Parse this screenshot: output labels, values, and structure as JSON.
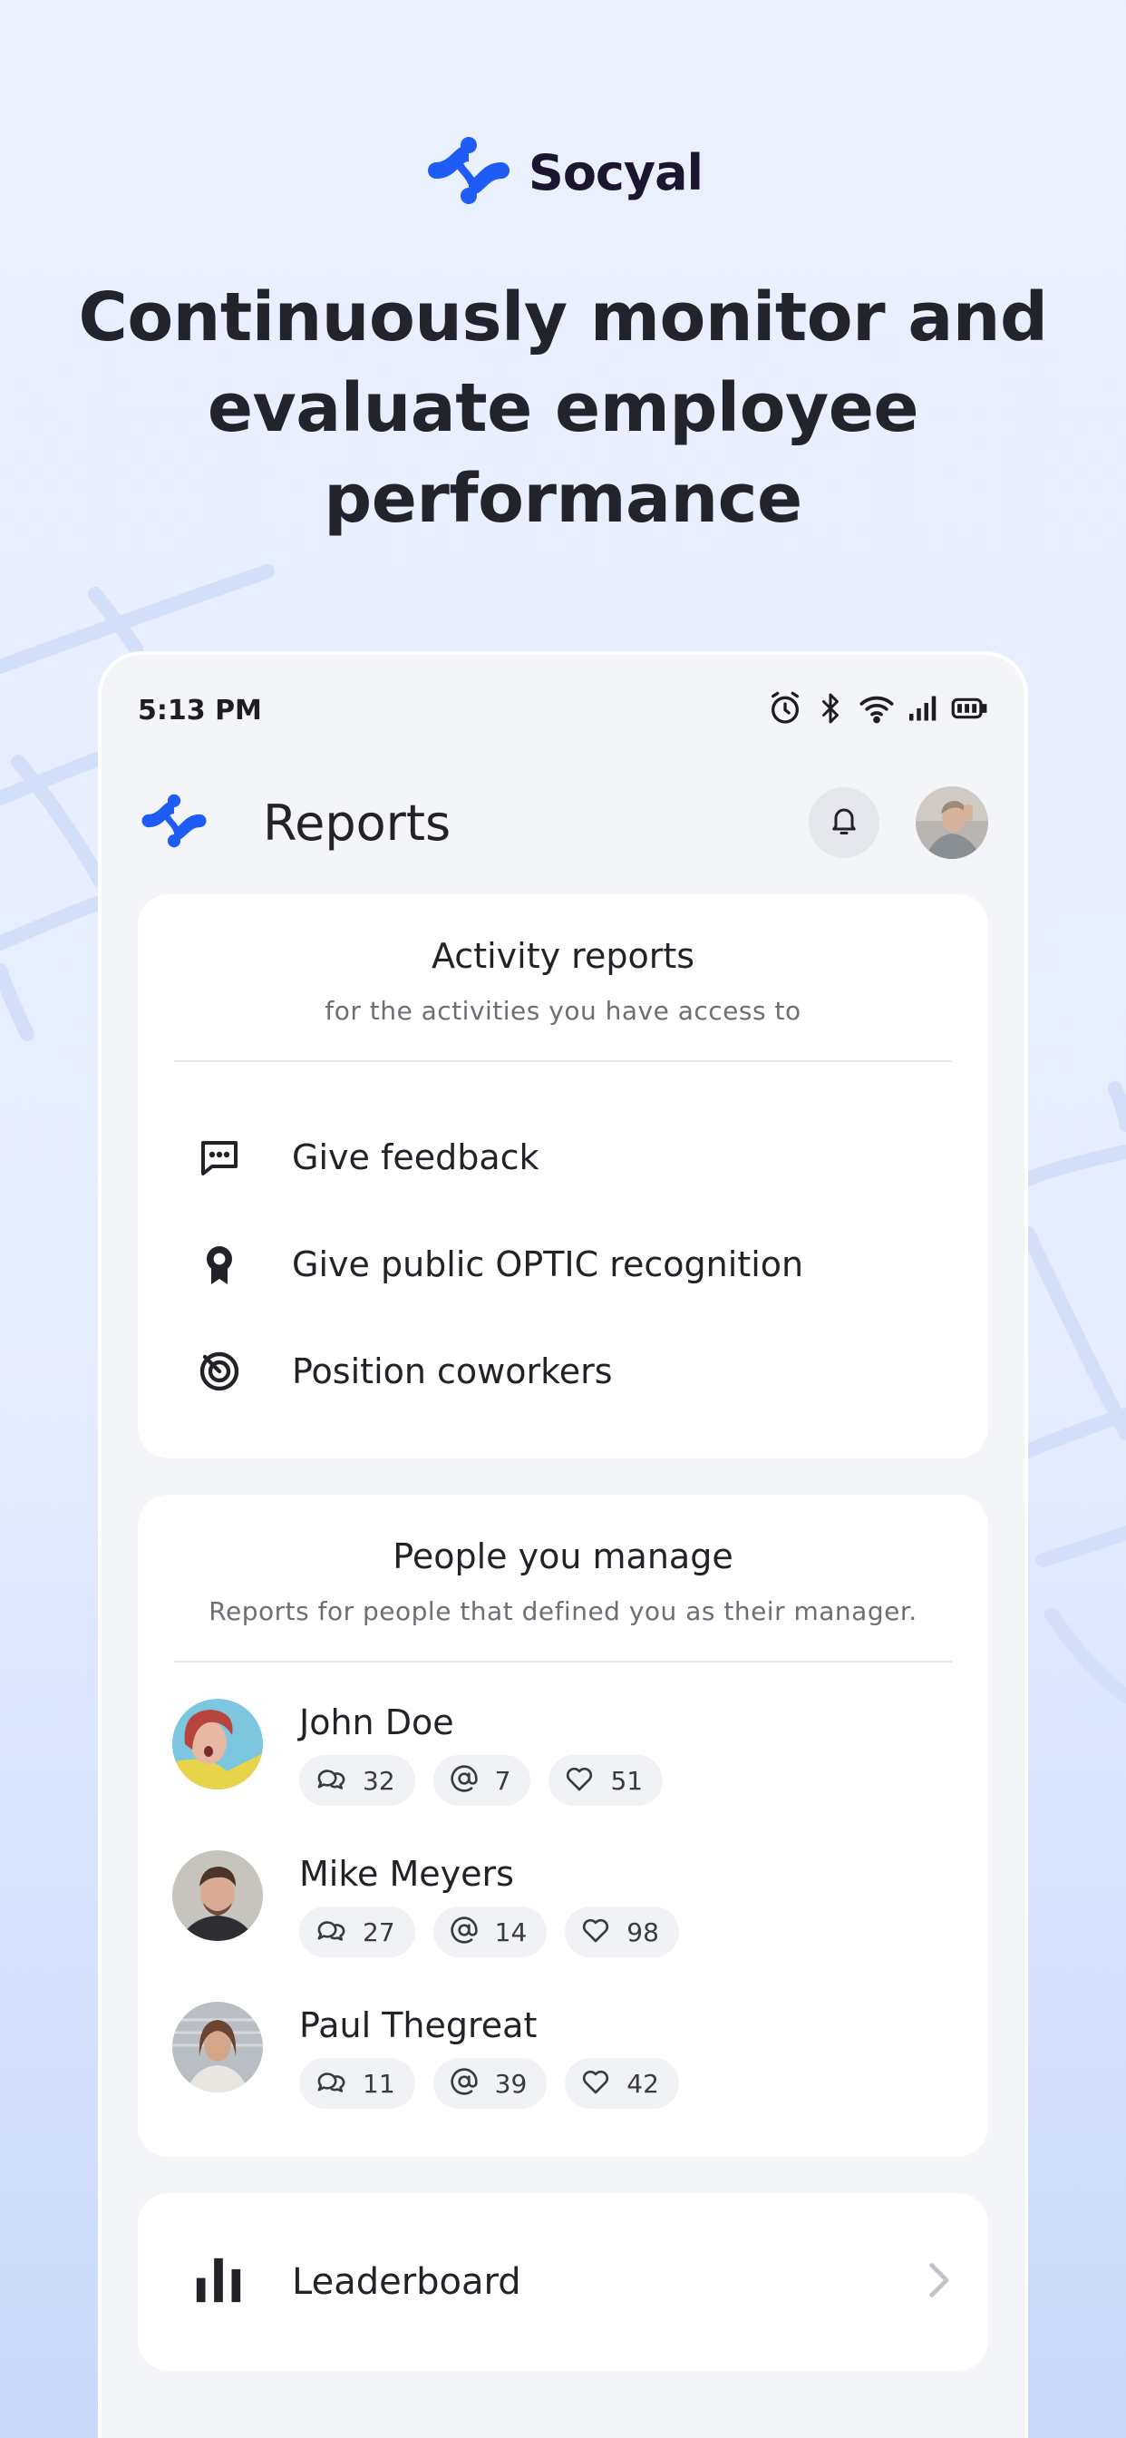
{
  "brand": {
    "name": "Socyal",
    "accent": "#1f5cf5"
  },
  "headline": [
    "Continuously monitor and",
    "evaluate employee",
    "performance"
  ],
  "status_bar": {
    "time": "5:13 PM",
    "icons": [
      "alarm-icon",
      "bluetooth-icon",
      "wifi-icon",
      "signal-icon",
      "battery-icon"
    ]
  },
  "app_header": {
    "title": "Reports",
    "icons": [
      "logo-icon",
      "bell-icon",
      "profile-avatar"
    ]
  },
  "activity_reports": {
    "title": "Activity reports",
    "subtitle": "for the activities you have access to",
    "items": [
      {
        "label": "Give feedback",
        "icon": "chat-dots-icon"
      },
      {
        "label": "Give public OPTIC recognition",
        "icon": "award-icon"
      },
      {
        "label": "Position coworkers",
        "icon": "target-icon"
      }
    ]
  },
  "people_you_manage": {
    "title": "People you manage",
    "subtitle": "Reports for people that defined you as their manager.",
    "people": [
      {
        "name": "John Doe",
        "comments": "32",
        "mentions": "7",
        "likes": "51"
      },
      {
        "name": "Mike Meyers",
        "comments": "27",
        "mentions": "14",
        "likes": "98"
      },
      {
        "name": "Paul Thegreat",
        "comments": "11",
        "mentions": "39",
        "likes": "42"
      }
    ]
  },
  "leaderboard": {
    "label": "Leaderboard",
    "icon": "bar-chart-icon"
  }
}
